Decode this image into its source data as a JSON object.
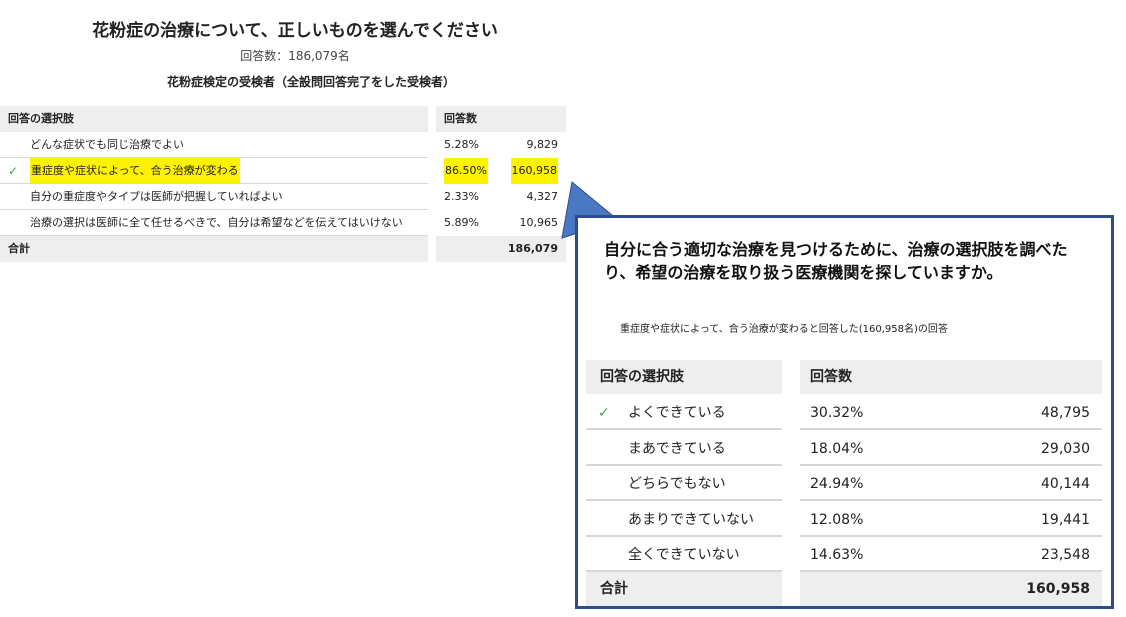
{
  "title": "花粉症の治療について、正しいものを選んでください",
  "response_count": "回答数：186,079名",
  "subtitle": "花粉症検定の受検者（全設問回答完了をした受検者）",
  "chart_data": [
    {
      "type": "table",
      "headers": [
        "回答の選択肢",
        "回答数"
      ],
      "rows": [
        {
          "label": "どんな症状でも同じ治療でよい",
          "percent": "5.28%",
          "count": "9,829",
          "correct": false
        },
        {
          "label": "重症度や症状によって、合う治療が変わる",
          "percent": "86.50%",
          "count": "160,958",
          "correct": true
        },
        {
          "label": "自分の重症度やタイプは医師が把握していればよい",
          "percent": "2.33%",
          "count": "4,327",
          "correct": false
        },
        {
          "label": "治療の選択は医師に全て任せるべきで、自分は希望などを伝えてはいけない",
          "percent": "5.89%",
          "count": "10,965",
          "correct": false
        }
      ],
      "total_label": "合計",
      "total": "186,079"
    },
    {
      "type": "table",
      "question": "自分に合う適切な治療を見つけるために、治療の選択肢を調べたり、希望の治療を取り扱う医療機関を探していますか。",
      "note": "重症度や症状によって、合う治療が変わると回答した(160,958名)の回答",
      "headers": [
        "回答の選択肢",
        "回答数"
      ],
      "rows": [
        {
          "label": "よくできている",
          "percent": "30.32%",
          "count": "48,795",
          "correct": true
        },
        {
          "label": "まあできている",
          "percent": "18.04%",
          "count": "29,030",
          "correct": false
        },
        {
          "label": "どちらでもない",
          "percent": "24.94%",
          "count": "40,144",
          "correct": false
        },
        {
          "label": "あまりできていない",
          "percent": "12.08%",
          "count": "19,441",
          "correct": false
        },
        {
          "label": "全くできていない",
          "percent": "14.63%",
          "count": "23,548",
          "correct": false
        }
      ],
      "total_label": "合計",
      "total": "160,958"
    }
  ],
  "colors": {
    "highlight": "#fff200",
    "check": "#3aa35a",
    "callout_border": "#2e4b8c",
    "header_bg": "#eeeeee"
  },
  "icons": {
    "correct": "check-icon"
  }
}
